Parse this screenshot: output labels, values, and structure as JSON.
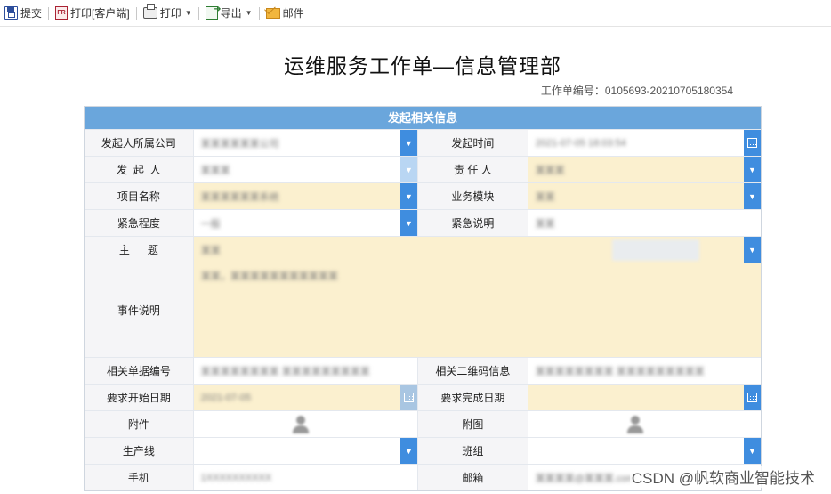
{
  "toolbar": {
    "submit": "提交",
    "print_client": "打印[客户端]",
    "print": "打印",
    "export": "导出",
    "mail": "邮件"
  },
  "page": {
    "title": "运维服务工作单—信息管理部",
    "order_no": "工作单编号：0105693-20210705180354"
  },
  "form": {
    "header": "发起相关信息",
    "labels": {
      "company": "发起人所属公司",
      "start_time": "发起时间",
      "initiator": "发  起  人",
      "owner": "责 任 人",
      "project": "项目名称",
      "module": "业务模块",
      "urgency": "紧急程度",
      "urgency_note": "紧急说明",
      "subject": "主      题",
      "description": "事件说明",
      "related_doc": "相关单据编号",
      "related_qr": "相关二维码信息",
      "req_start": "要求开始日期",
      "req_finish": "要求完成日期",
      "attachment": "附件",
      "figure": "附图",
      "line": "生产线",
      "team": "班组",
      "phone": "手机",
      "email": "邮箱"
    },
    "values": {
      "company": "某某某某某某公司",
      "start_time": "2021-07-05 18:03:54",
      "initiator": "某某某",
      "owner": "某某某",
      "project": "某某某某某某系统",
      "module": "某某",
      "urgency": "一般",
      "urgency_note": "某某",
      "subject": "某某",
      "description": "某某，某某某某某某某某某某某",
      "related_doc": "某某某某某某某某  某某某某某某某某某",
      "related_qr": "某某某某某某某某  某某某某某某某某某",
      "req_start": "2021-07-05",
      "phone": "1XXXXXXXXXX",
      "email": "某某某某@某某某.com"
    }
  },
  "watermark": "CSDN @帆软商业智能技术",
  "colors": {
    "header_blue": "#6aa6dc",
    "button_blue": "#3f8ddf",
    "field_yellow": "#fbf0cf",
    "label_grey": "#f5f5f7"
  }
}
